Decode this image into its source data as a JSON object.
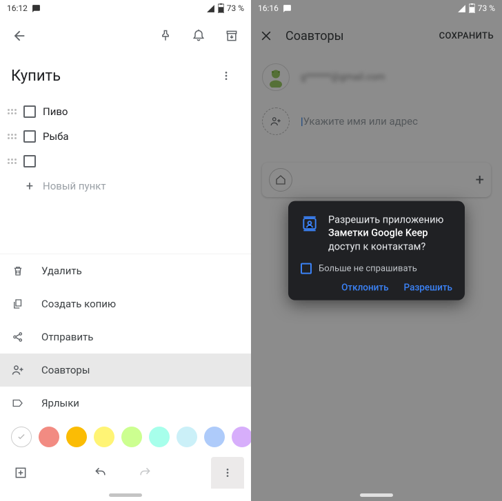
{
  "left": {
    "status": {
      "time": "16:12",
      "battery": "73 %"
    },
    "note": {
      "title": "Купить",
      "items": [
        "Пиво",
        "Рыба",
        ""
      ],
      "new_item_placeholder": "Новый пункт"
    },
    "menu": {
      "delete": "Удалить",
      "copy": "Создать копию",
      "send": "Отправить",
      "collaborators": "Соавторы",
      "labels": "Ярлыки"
    },
    "colors": [
      "#ffffff",
      "#f28b82",
      "#fbbc04",
      "#fff475",
      "#ccff90",
      "#a7ffeb",
      "#cbf0f8",
      "#aecbfa",
      "#d7aefb"
    ]
  },
  "right": {
    "status": {
      "time": "16:16",
      "battery": "73 %"
    },
    "header": {
      "title": "Соавторы",
      "save": "СОХРАНИТЬ"
    },
    "owner_email": "g******@gmail.com",
    "input_placeholder": "Укажите имя или адрес",
    "dialog": {
      "line1": "Разрешить приложению ",
      "app": "Заметки Google Keep",
      "line2": " доступ к контактам?",
      "dont_ask": "Больше не спрашивать",
      "deny": "Отклонить",
      "allow": "Разрешить"
    }
  }
}
